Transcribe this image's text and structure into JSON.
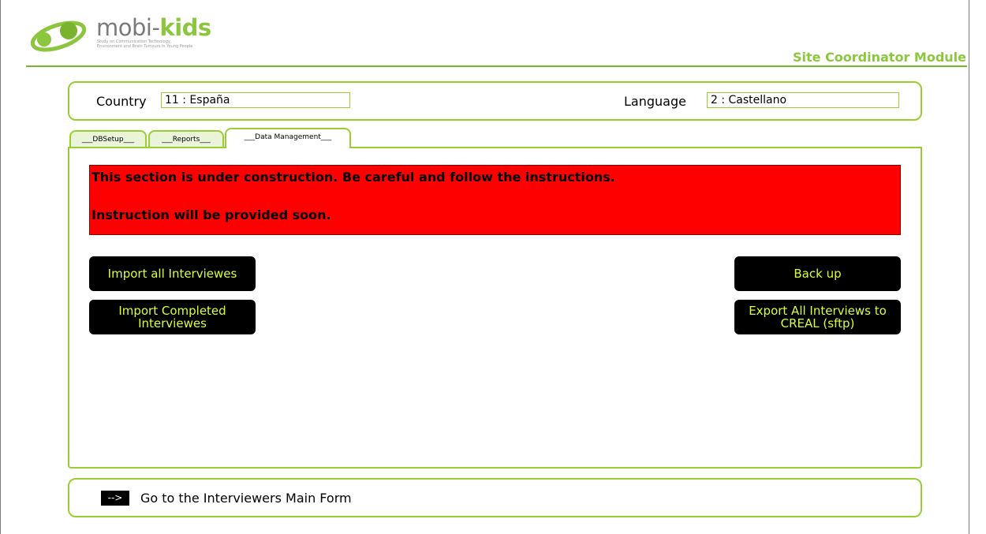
{
  "header": {
    "brand_prefix": "mobi-",
    "brand_bold": "kids",
    "tagline_line1": "Study on Communication Technology,",
    "tagline_line2": "Environment and Brain Tumours in Young People",
    "module_title": "Site Coordinator Module"
  },
  "selectors": {
    "country_label": "Country",
    "country_value": "11 : España",
    "language_label": "Language",
    "language_value": "2 : Castellano"
  },
  "tabs": [
    {
      "label": "___DBSetup___",
      "active": false
    },
    {
      "label": "___Reports___",
      "active": false
    },
    {
      "label": "___Data Management___",
      "active": true
    }
  ],
  "warning": {
    "line1": "This section is under construction. Be careful and follow the instructions.",
    "line2": "Instruction will be provided soon."
  },
  "buttons": {
    "import_all": "Import all Interviewes",
    "import_completed": "Import Completed Interviewes",
    "back_up": "Back up",
    "export_all": "Export All Interviews to CREAL (sftp)"
  },
  "footer": {
    "arrow_label": "-->",
    "link_text": "Go to the Interviewers Main Form"
  },
  "colors": {
    "accent_green": "#9acd32",
    "brand_green": "#8cc63f",
    "warning_red": "#ff0000",
    "button_text": "#d8ff3a"
  }
}
